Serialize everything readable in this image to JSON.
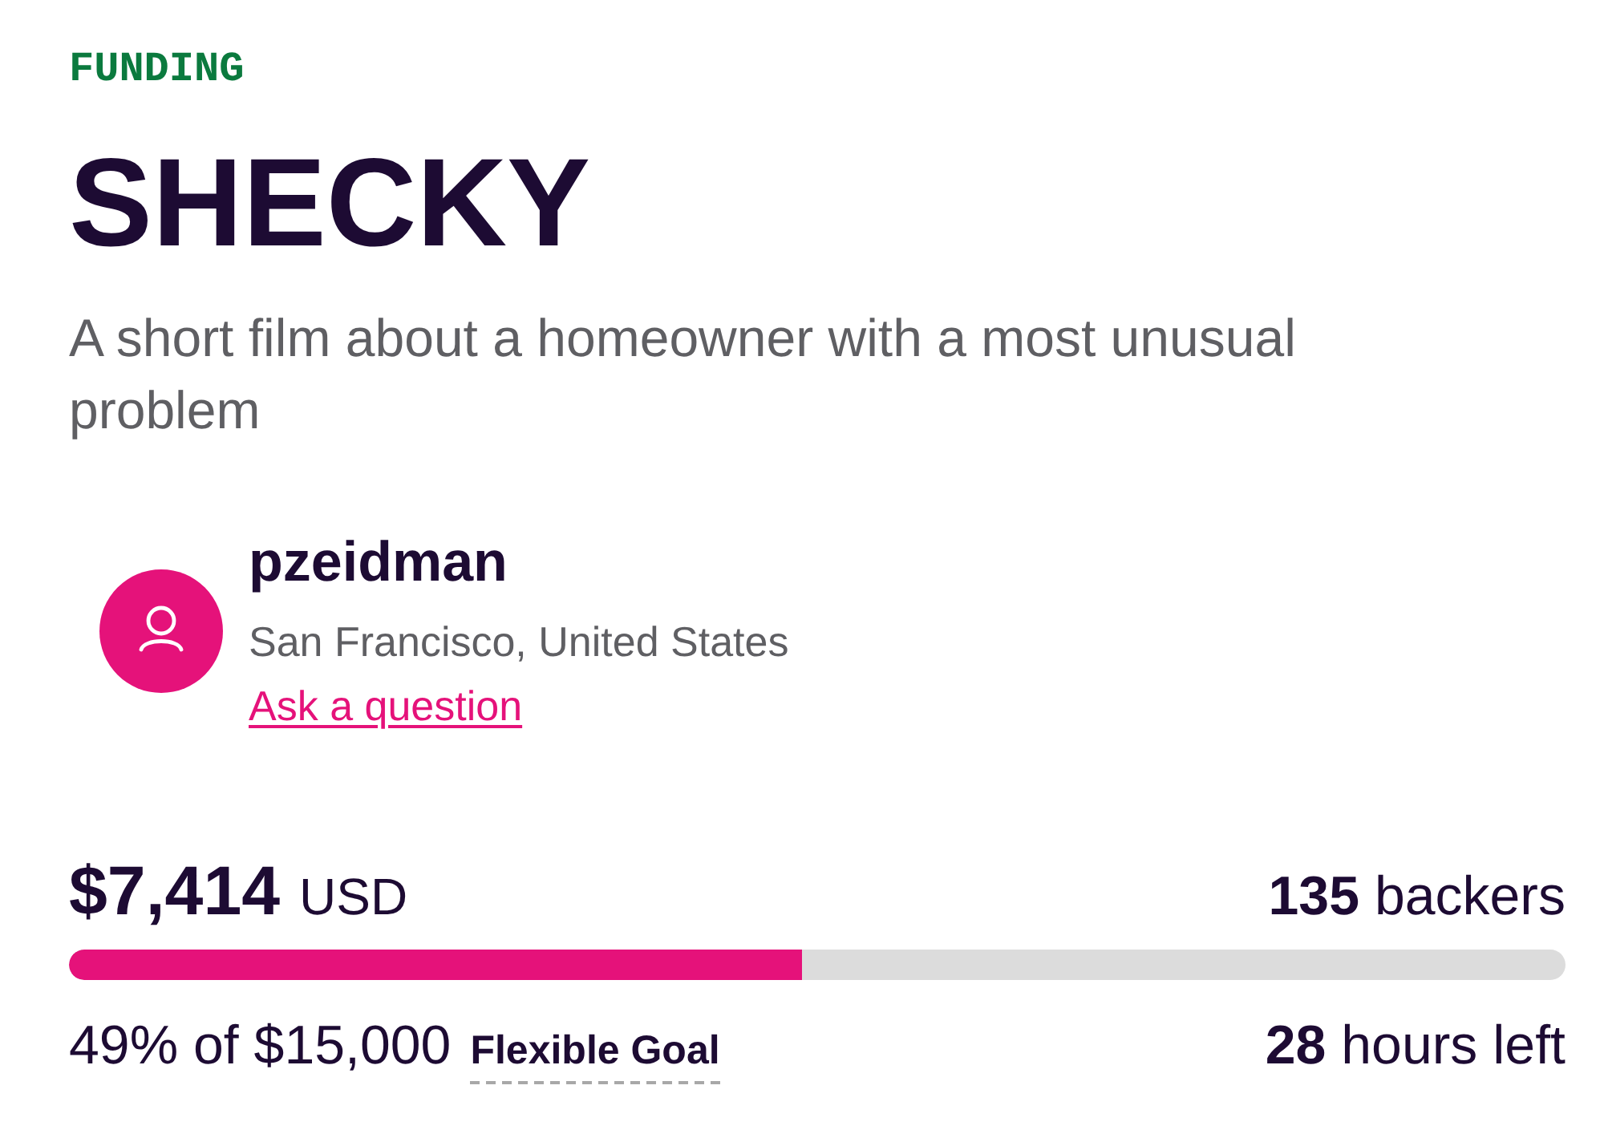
{
  "category": "FUNDING",
  "title": "SHECKY",
  "description": "A short film about a homeowner with a most unusual problem",
  "creator": {
    "name": "pzeidman",
    "location": "San Francisco, United States",
    "link": "Ask a question"
  },
  "pledged": {
    "amount": "$7,414",
    "currency": "USD"
  },
  "backers": "**135** backers",
  "progress": {
    "level": 0.49
  },
  "goal": {
    "text": "49% of $15,000",
    "type": "Flexible Goal"
  },
  "time_left": "**28** hours left"
}
